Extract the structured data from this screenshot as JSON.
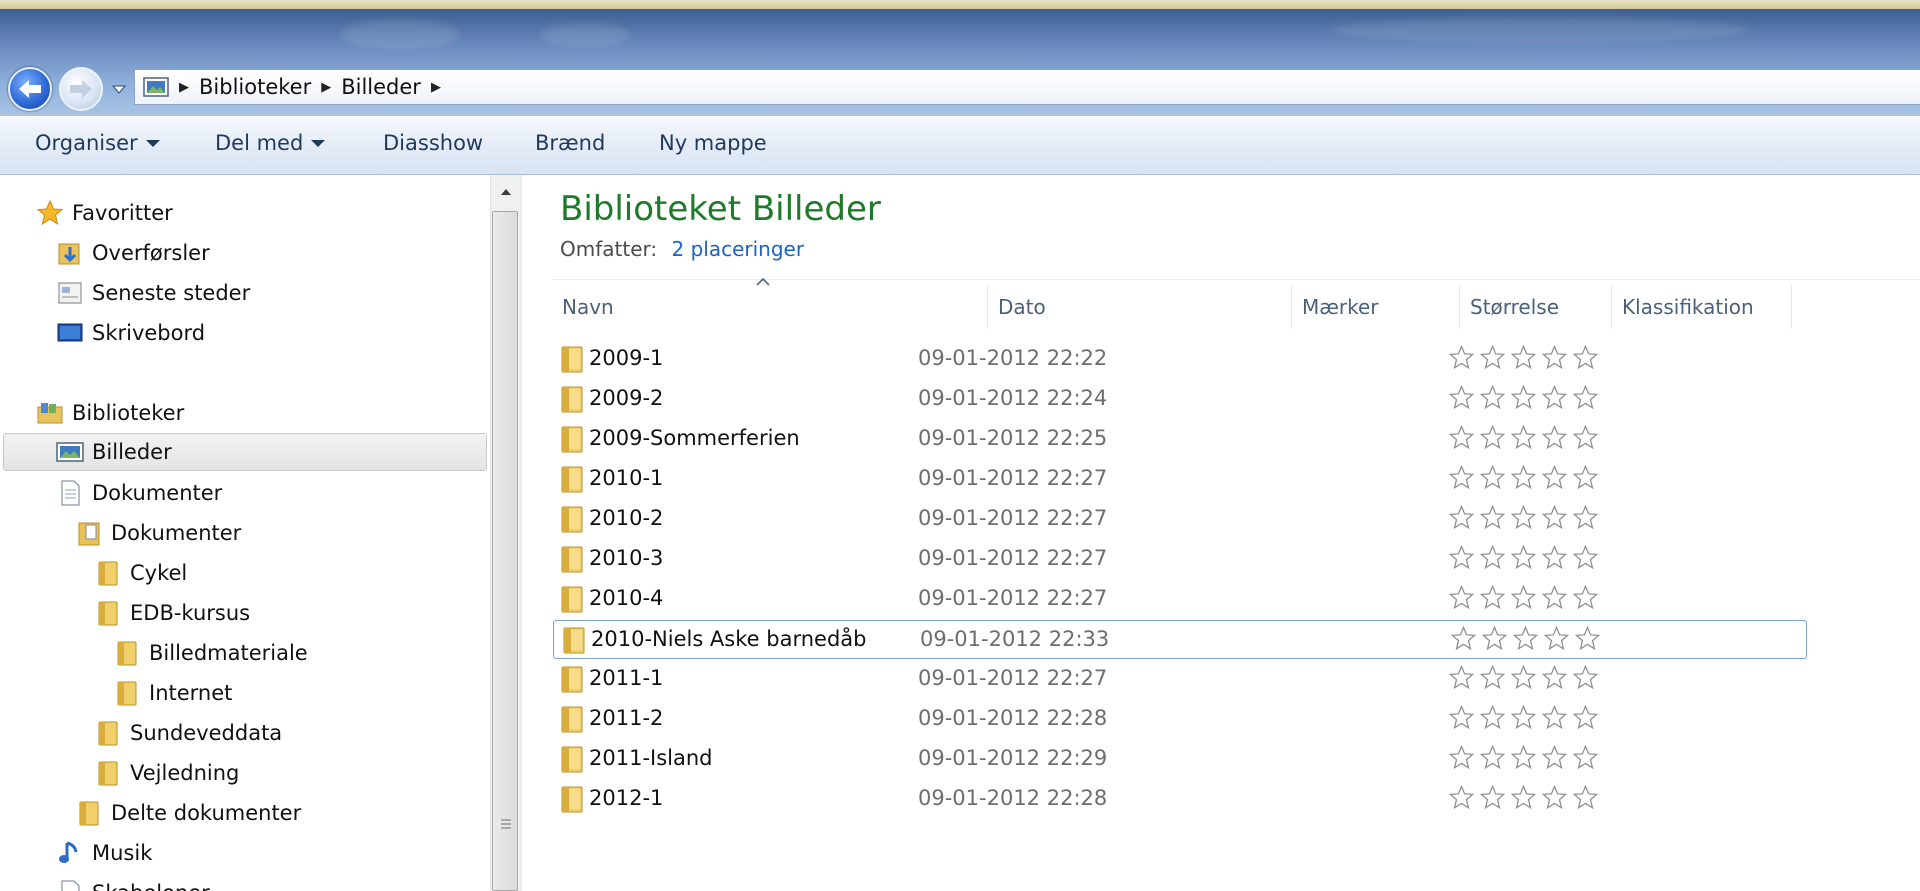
{
  "address": {
    "crumbs": [
      "Biblioteker",
      "Billeder"
    ],
    "icons": {
      "back": "back-arrow-icon",
      "forward": "forward-arrow-icon",
      "location": "pictures-library-icon"
    }
  },
  "toolbar": {
    "organise": "Organiser",
    "share": "Del med",
    "slideshow": "Diasshow",
    "burn": "Brænd",
    "new_folder": "Ny mappe"
  },
  "navigation": {
    "favorites": "Favoritter",
    "downloads": "Overførsler",
    "recent": "Seneste steder",
    "desktop": "Skrivebord",
    "libraries": "Biblioteker",
    "pictures": "Billeder",
    "documents": "Dokumenter",
    "documents_sub": "Dokumenter",
    "cykel": "Cykel",
    "edb": "EDB-kursus",
    "billedmateriale": "Billedmateriale",
    "internet": "Internet",
    "sundeved": "Sundeveddata",
    "vejledning": "Vejledning",
    "delte": "Delte dokumenter",
    "music": "Musik",
    "partial": "Skabeloner"
  },
  "library": {
    "title": "Biblioteket Billeder",
    "includes_label": "Omfatter:",
    "includes_link": "2 placeringer"
  },
  "columns": {
    "name": "Navn",
    "date": "Dato",
    "tags": "Mærker",
    "size": "Størrelse",
    "rating": "Klassifikation"
  },
  "files": [
    {
      "name": "2009-1",
      "date": "09-01-2012 22:22",
      "rating": 0
    },
    {
      "name": "2009-2",
      "date": "09-01-2012 22:24",
      "rating": 0
    },
    {
      "name": "2009-Sommerferien",
      "date": "09-01-2012 22:25",
      "rating": 0
    },
    {
      "name": "2010-1",
      "date": "09-01-2012 22:27",
      "rating": 0
    },
    {
      "name": "2010-2",
      "date": "09-01-2012 22:27",
      "rating": 0
    },
    {
      "name": "2010-3",
      "date": "09-01-2012 22:27",
      "rating": 0
    },
    {
      "name": "2010-4",
      "date": "09-01-2012 22:27",
      "rating": 0
    },
    {
      "name": "2010-Niels Aske barnedåb",
      "date": "09-01-2012 22:33",
      "rating": 0
    },
    {
      "name": "2011-1",
      "date": "09-01-2012 22:27",
      "rating": 0
    },
    {
      "name": "2011-2",
      "date": "09-01-2012 22:28",
      "rating": 0
    },
    {
      "name": "2011-Island",
      "date": "09-01-2012 22:29",
      "rating": 0
    },
    {
      "name": "2012-1",
      "date": "09-01-2012 22:28",
      "rating": 0
    }
  ],
  "focused_index": 7
}
